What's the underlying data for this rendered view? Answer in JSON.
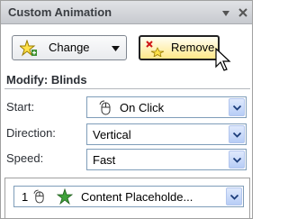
{
  "pane": {
    "title": "Custom Animation",
    "menu_icon": "chevron-down-icon",
    "close_icon": "close-icon"
  },
  "toolbar": {
    "change_label": "Change",
    "change_icon": "add-effect-star-icon",
    "remove_label": "Remove",
    "remove_icon": "remove-effect-icon"
  },
  "modify": {
    "heading": "Modify: Blinds",
    "start_label": "Start:",
    "start_value": "On Click",
    "start_icon": "mouse-icon",
    "direction_label": "Direction:",
    "direction_value": "Vertical",
    "speed_label": "Speed:",
    "speed_value": "Fast"
  },
  "effects_list": {
    "items": [
      {
        "index": "1",
        "trigger_icon": "mouse-icon",
        "effect_icon": "entrance-effect-star-icon",
        "name": "Content Placeholde..."
      }
    ]
  },
  "colors": {
    "titlebar": "#c7cacf",
    "remove_highlight": "#ffe889",
    "dropdown_button": "#b7cdf6"
  }
}
